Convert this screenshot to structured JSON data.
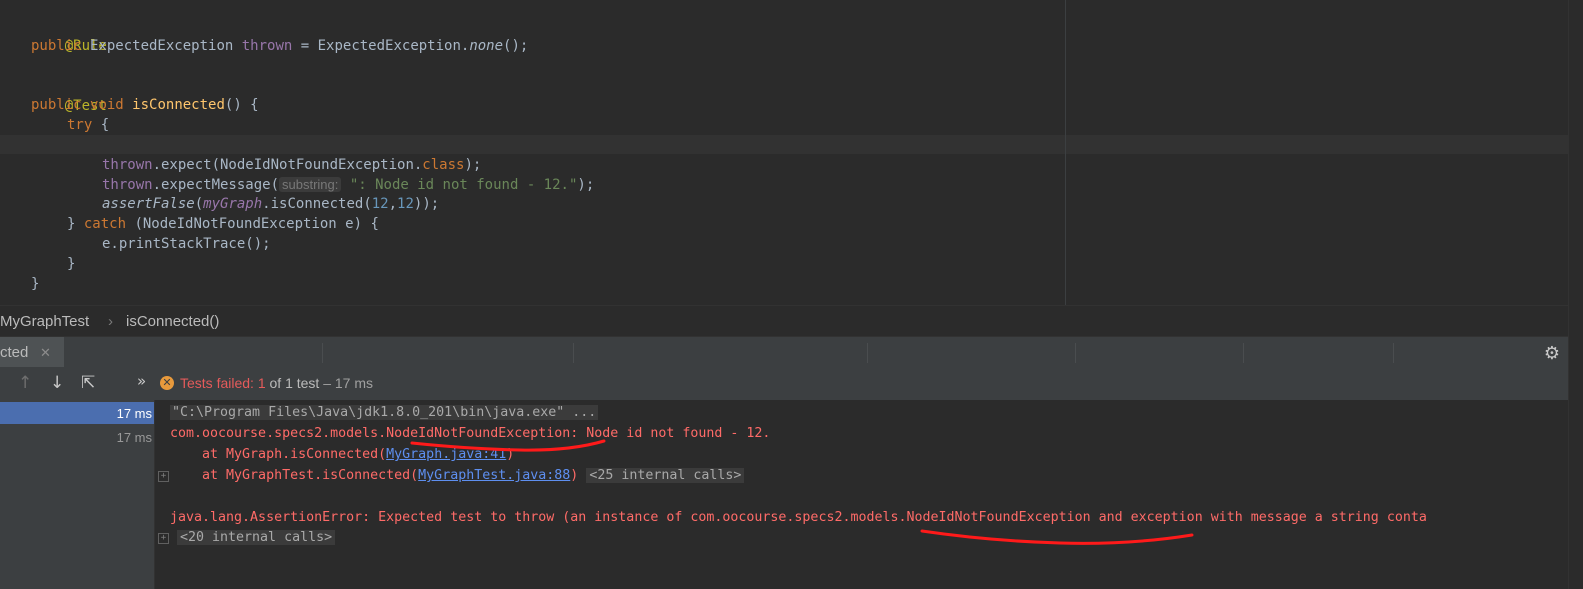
{
  "editor": {
    "lines": {
      "l1_annotation": "@Rule",
      "l2_public": "public",
      "l2_type": " ExpectedException ",
      "l2_field": "thrown",
      "l2_eq": " = ExpectedException.",
      "l2_method": "none",
      "l2_end": "();",
      "l4_annotation": "@Test",
      "l5_public": "public ",
      "l5_void": "void ",
      "l5_method": "isConnected",
      "l5_end": "() {",
      "l6_try": "try",
      "l6_end": " {",
      "l8_field": "thrown",
      "l8_call": ".expect(NodeIdNotFoundException.",
      "l8_class": "class",
      "l8_end": ");",
      "l9_field": "thrown",
      "l9_call": ".expectMessage(",
      "l9_hint": "substring:",
      "l9_string": " \": Node id not found - 12.\"",
      "l9_end": ");",
      "l10_assert": "assertFalse",
      "l10_open": "(",
      "l10_field": "myGraph",
      "l10_call": ".isConnected(",
      "l10_num1": "12",
      "l10_comma": ",",
      "l10_num2": "12",
      "l10_end": "));",
      "l11_close": "} ",
      "l11_catch": "catch",
      "l11_end": " (NodeIdNotFoundException e) {",
      "l12_call": "e.printStackTrace();",
      "l13_close": "}",
      "l14_close": "}"
    }
  },
  "breadcrumb": {
    "class_name": "MyGraphTest",
    "separator": "›",
    "method_name": "isConnected()"
  },
  "run_panel": {
    "tab_label": "cted",
    "close_glyph": "✕",
    "gear_glyph": "⚙"
  },
  "toolbar": {
    "up_glyph": "↑",
    "down_glyph": "↓",
    "export_glyph": "⇱",
    "more_glyph": "»",
    "fail_glyph": "✕",
    "status_prefix": "Tests failed: ",
    "failed_count": "1",
    "of_text": " of 1 test",
    "duration": " – 17 ms"
  },
  "test_tree": {
    "rows": [
      {
        "duration": "17 ms"
      },
      {
        "duration": "17 ms"
      }
    ]
  },
  "console": {
    "command": "\"C:\\Program Files\\Java\\jdk1.8.0_201\\bin\\java.exe\" ...",
    "exception_line": "com.oocourse.specs2.models.NodeIdNotFoundException: Node id not found - 12.",
    "at1_prefix": "    at MyGraph.isConnected(",
    "at1_link": "MyGraph.java:41",
    "at1_suffix": ")",
    "at2_prefix": "    at MyGraphTest.isConnected(",
    "at2_link": "MyGraphTest.java:88",
    "at2_suffix": ")",
    "at2_internal": "<25 internal calls>",
    "assertion_line": "java.lang.AssertionError: Expected test to throw (an instance of com.oocourse.specs2.models.NodeIdNotFoundException and exception with message a string conta",
    "internal_calls": "<20 internal calls>",
    "fold_glyph": "+"
  },
  "colors": {
    "error_red": "#ff6b68",
    "annotation_underline": "#ff1a1a",
    "selection_blue": "#4b6eaf"
  }
}
